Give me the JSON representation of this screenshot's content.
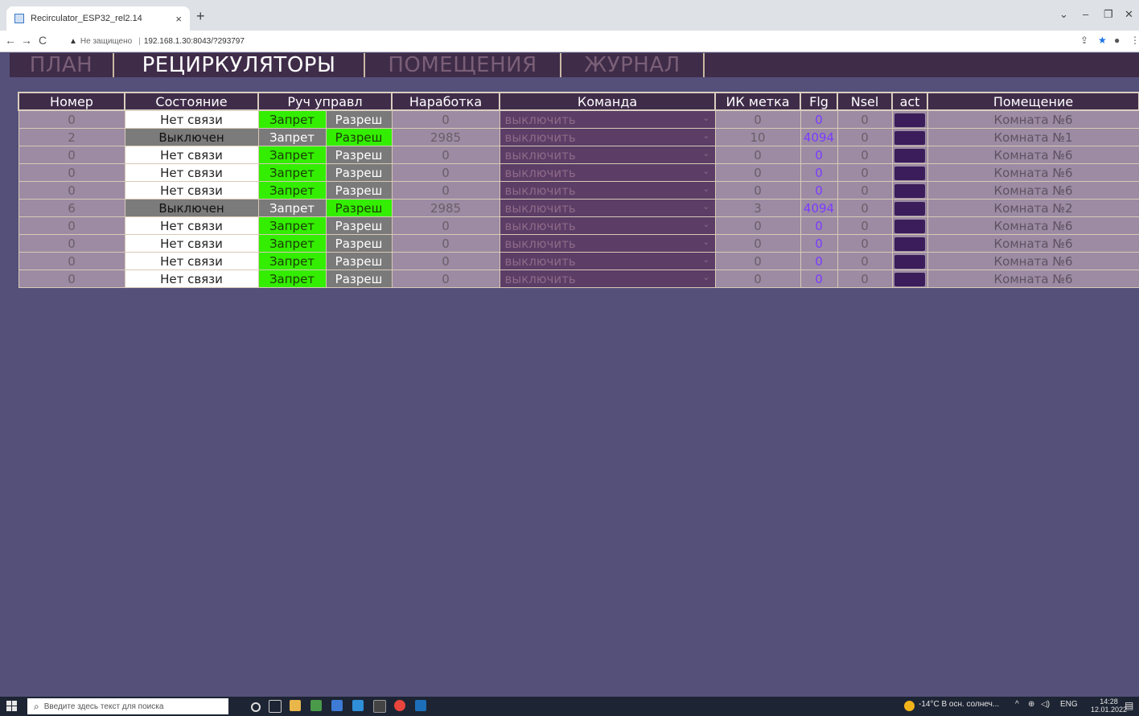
{
  "browser": {
    "tab_title": "Recirculator_ESP32_rel2.14",
    "tab_close": "×",
    "new_tab": "+",
    "security_label": "Не защищено",
    "url": "192.168.1.30:8043/?293797",
    "window_min": "–",
    "window_max": "❐",
    "window_close": "✕",
    "chevron": "⌄"
  },
  "menu": {
    "items": [
      {
        "label": "ПЛАН",
        "active": false
      },
      {
        "label": "РЕЦИРКУЛЯТОРЫ",
        "active": true
      },
      {
        "label": "ПОМЕЩЕНИЯ",
        "active": false
      },
      {
        "label": "ЖУРНАЛ",
        "active": false
      }
    ]
  },
  "table": {
    "headers": [
      "Номер",
      "Состояние",
      "Руч управл",
      "Наработка",
      "Команда",
      "ИК метка",
      "Flg",
      "Nsel",
      "act",
      "Помещение"
    ],
    "rows": [
      {
        "num": "0",
        "state": "Нет связи",
        "state_off": false,
        "zapret": "Запрет",
        "razresh": "Разреш",
        "active": "zapret",
        "hours": "0",
        "command": "выключить",
        "ir": "0",
        "flg": "0",
        "nsel": "0",
        "room": "Комната №6"
      },
      {
        "num": "2",
        "state": "Выключен",
        "state_off": true,
        "zapret": "Запрет",
        "razresh": "Разреш",
        "active": "razresh",
        "hours": "2985",
        "command": "выключить",
        "ir": "10",
        "flg": "4094",
        "nsel": "0",
        "room": "Комната №1"
      },
      {
        "num": "0",
        "state": "Нет связи",
        "state_off": false,
        "zapret": "Запрет",
        "razresh": "Разреш",
        "active": "zapret",
        "hours": "0",
        "command": "выключить",
        "ir": "0",
        "flg": "0",
        "nsel": "0",
        "room": "Комната №6"
      },
      {
        "num": "0",
        "state": "Нет связи",
        "state_off": false,
        "zapret": "Запрет",
        "razresh": "Разреш",
        "active": "zapret",
        "hours": "0",
        "command": "выключить",
        "ir": "0",
        "flg": "0",
        "nsel": "0",
        "room": "Комната №6"
      },
      {
        "num": "0",
        "state": "Нет связи",
        "state_off": false,
        "zapret": "Запрет",
        "razresh": "Разреш",
        "active": "zapret",
        "hours": "0",
        "command": "выключить",
        "ir": "0",
        "flg": "0",
        "nsel": "0",
        "room": "Комната №6"
      },
      {
        "num": "6",
        "state": "Выключен",
        "state_off": true,
        "zapret": "Запрет",
        "razresh": "Разреш",
        "active": "razresh",
        "hours": "2985",
        "command": "выключить",
        "ir": "3",
        "flg": "4094",
        "nsel": "0",
        "room": "Комната №2"
      },
      {
        "num": "0",
        "state": "Нет связи",
        "state_off": false,
        "zapret": "Запрет",
        "razresh": "Разреш",
        "active": "zapret",
        "hours": "0",
        "command": "выключить",
        "ir": "0",
        "flg": "0",
        "nsel": "0",
        "room": "Комната №6"
      },
      {
        "num": "0",
        "state": "Нет связи",
        "state_off": false,
        "zapret": "Запрет",
        "razresh": "Разреш",
        "active": "zapret",
        "hours": "0",
        "command": "выключить",
        "ir": "0",
        "flg": "0",
        "nsel": "0",
        "room": "Комната №6"
      },
      {
        "num": "0",
        "state": "Нет связи",
        "state_off": false,
        "zapret": "Запрет",
        "razresh": "Разреш",
        "active": "zapret",
        "hours": "0",
        "command": "выключить",
        "ir": "0",
        "flg": "0",
        "nsel": "0",
        "room": "Комната №6"
      },
      {
        "num": "0",
        "state": "Нет связи",
        "state_off": false,
        "zapret": "Запрет",
        "razresh": "Разреш",
        "active": "zapret",
        "hours": "0",
        "command": "выключить",
        "ir": "0",
        "flg": "0",
        "nsel": "0",
        "room": "Комната №6"
      }
    ]
  },
  "taskbar": {
    "search_placeholder": "Введите здесь текст для поиска",
    "weather": "-14°C В осн. солнеч...",
    "lang": "ENG",
    "time": "14:28",
    "date": "12.01.2022"
  },
  "colors": {
    "page_bg": "#54507a",
    "header_bg": "#3f2c49",
    "active_green": "#33ee00",
    "inactive_grey": "#7a7a7a",
    "command_bg": "#5b3d66",
    "flag_purple": "#7b3cff"
  }
}
